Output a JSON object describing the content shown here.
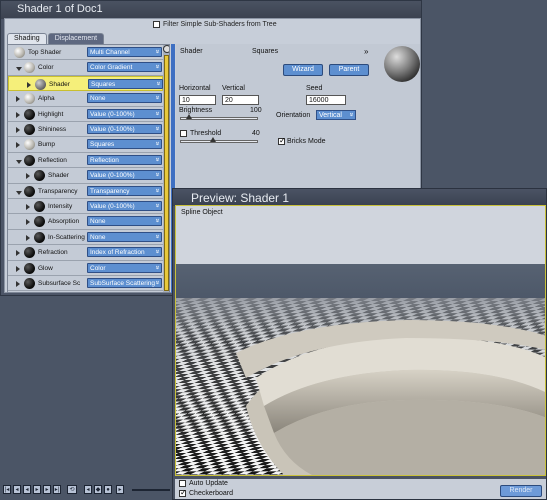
{
  "shader_window": {
    "title": "Shader 1 of Doc1",
    "filter_label": "Filter Simple Sub-Shaders from Tree",
    "filter_checked": false,
    "tabs": [
      {
        "label": "Shading",
        "active": true
      },
      {
        "label": "Displacement",
        "active": false
      }
    ],
    "tree_rows": [
      {
        "label": "Top Shader",
        "value": "Multi Channel",
        "ball": "grey"
      },
      {
        "label": "Color",
        "value": "Color Gradient",
        "ball": "grey"
      },
      {
        "label": "Shader",
        "value": "Squares",
        "ball": "darkgrey",
        "selected": true
      },
      {
        "label": "Alpha",
        "value": "None",
        "ball": "grey"
      },
      {
        "label": "Highlight",
        "value": "Value (0-100%)",
        "ball": "black"
      },
      {
        "label": "Shininess",
        "value": "Value (0-100%)",
        "ball": "black"
      },
      {
        "label": "Bump",
        "value": "Squares",
        "ball": "grey"
      },
      {
        "label": "Reflection",
        "value": "Reflection",
        "ball": "black"
      },
      {
        "label": "Shader",
        "value": "Value (0-100%)",
        "ball": "black"
      },
      {
        "label": "Transparency",
        "value": "Transparency",
        "ball": "black"
      },
      {
        "label": "Intensity",
        "value": "Value (0-100%)",
        "ball": "black"
      },
      {
        "label": "Absorption",
        "value": "None",
        "ball": "black"
      },
      {
        "label": "In-Scattering",
        "value": "None",
        "ball": "black"
      },
      {
        "label": "Refraction",
        "value": "Index of Refraction",
        "ball": "black"
      },
      {
        "label": "Glow",
        "value": "Color",
        "ball": "black"
      },
      {
        "label": "Subsurface Sc",
        "value": "SubSurface Scattering",
        "ball": "black"
      }
    ],
    "props": {
      "shader_label": "Shader",
      "shader_value": "Squares",
      "wizard_label": "Wizard",
      "parent_label": "Parent",
      "horizontal_label": "Horizontal",
      "horizontal_value": "10",
      "vertical_label": "Vertical",
      "vertical_value": "20",
      "seed_label": "Seed",
      "seed_value": "16000",
      "brightness_label": "Brightness",
      "brightness_value": "100",
      "orientation_label": "Orientation",
      "orientation_value": "Vertical",
      "threshold_label": "Threshold",
      "threshold_value": "40",
      "threshold_checked": false,
      "bricks_label": "Bricks Mode",
      "bricks_checked": true
    }
  },
  "preview_window": {
    "title": "Preview: Shader 1",
    "object_label": "Spline Object",
    "auto_update_label": "Auto Update",
    "auto_update_checked": false,
    "checkerboard_label": "Checkerboard",
    "checkerboard_checked": true,
    "render_label": "Render"
  },
  "colors": {
    "accent_blue": "#5d8fd0",
    "selection_yellow": "#f5ef7a",
    "panel_grey": "#c7ced9",
    "window_dark": "#4c5567"
  }
}
